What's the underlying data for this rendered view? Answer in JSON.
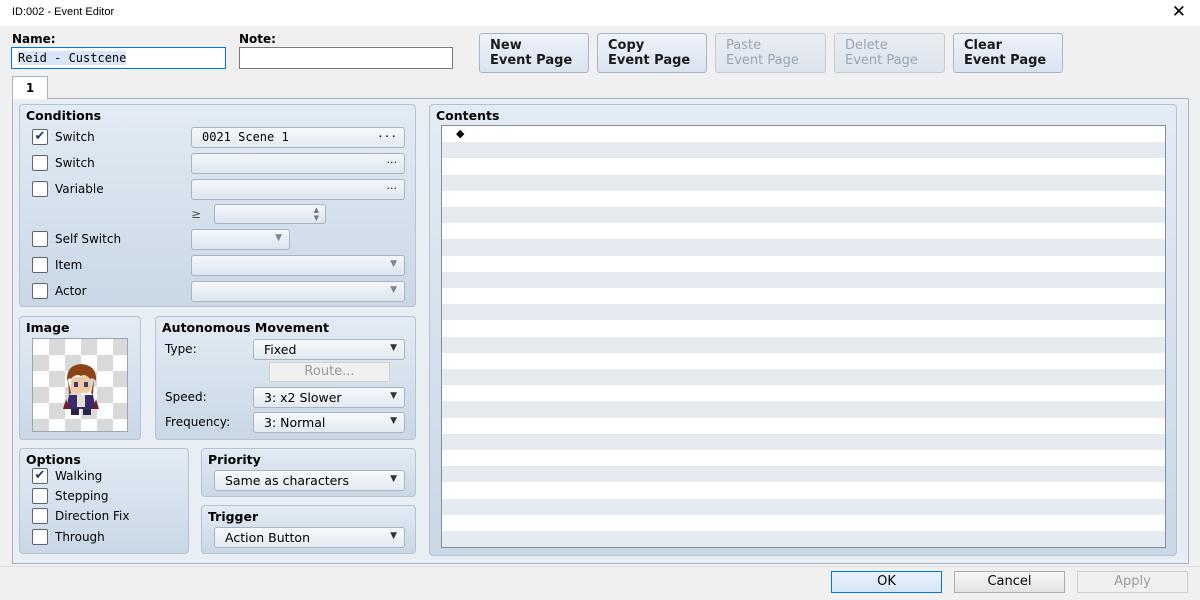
{
  "window": {
    "title": "ID:002 - Event Editor",
    "close_glyph": "✕"
  },
  "name_field": {
    "label": "Name:",
    "value": "Reid - Custcene"
  },
  "note_field": {
    "label": "Note:",
    "value": ""
  },
  "page_buttons": {
    "new": {
      "line1": "New",
      "line2": "Event Page",
      "enabled": true
    },
    "copy": {
      "line1": "Copy",
      "line2": "Event Page",
      "enabled": true
    },
    "paste": {
      "line1": "Paste",
      "line2": "Event Page",
      "enabled": false
    },
    "delete": {
      "line1": "Delete",
      "line2": "Event Page",
      "enabled": false
    },
    "clear": {
      "line1": "Clear",
      "line2": "Event Page",
      "enabled": true
    }
  },
  "tabs": [
    {
      "label": "1",
      "selected": true
    }
  ],
  "conditions": {
    "title": "Conditions",
    "switch1": {
      "label": "Switch",
      "checked": true,
      "value": "0021 Scene 1",
      "button_glyph": "···"
    },
    "switch2": {
      "label": "Switch",
      "checked": false,
      "value": "",
      "button_glyph": "···"
    },
    "variable": {
      "label": "Variable",
      "checked": false,
      "value": "",
      "button_glyph": "···"
    },
    "variable_op": "≥",
    "self_switch": {
      "label": "Self Switch",
      "checked": false
    },
    "item": {
      "label": "Item",
      "checked": false
    },
    "actor": {
      "label": "Actor",
      "checked": false
    }
  },
  "image": {
    "title": "Image",
    "icon": "character-sprite-icon"
  },
  "autonomous_movement": {
    "title": "Autonomous Movement",
    "type_label": "Type:",
    "type_value": "Fixed",
    "route_button": "Route...",
    "speed_label": "Speed:",
    "speed_value": "3: x2 Slower",
    "frequency_label": "Frequency:",
    "frequency_value": "3: Normal"
  },
  "options": {
    "title": "Options",
    "walking": {
      "label": "Walking",
      "checked": true
    },
    "stepping": {
      "label": "Stepping",
      "checked": false
    },
    "direction_fix": {
      "label": "Direction Fix",
      "checked": false
    },
    "through": {
      "label": "Through",
      "checked": false
    }
  },
  "priority": {
    "title": "Priority",
    "value": "Same as characters"
  },
  "trigger": {
    "title": "Trigger",
    "value": "Action Button"
  },
  "contents": {
    "title": "Contents",
    "first_line_glyph": "◆"
  },
  "footer": {
    "ok": "OK",
    "cancel": "Cancel",
    "apply": "Apply"
  },
  "glyphs": {
    "check": "✔",
    "arrow_down": "▼",
    "spin_up": "▲",
    "spin_down": "▼"
  },
  "colors": {
    "accent": "#0078d7",
    "panel": "#d6e0ec",
    "row_stripe": "#e5ebf1"
  }
}
